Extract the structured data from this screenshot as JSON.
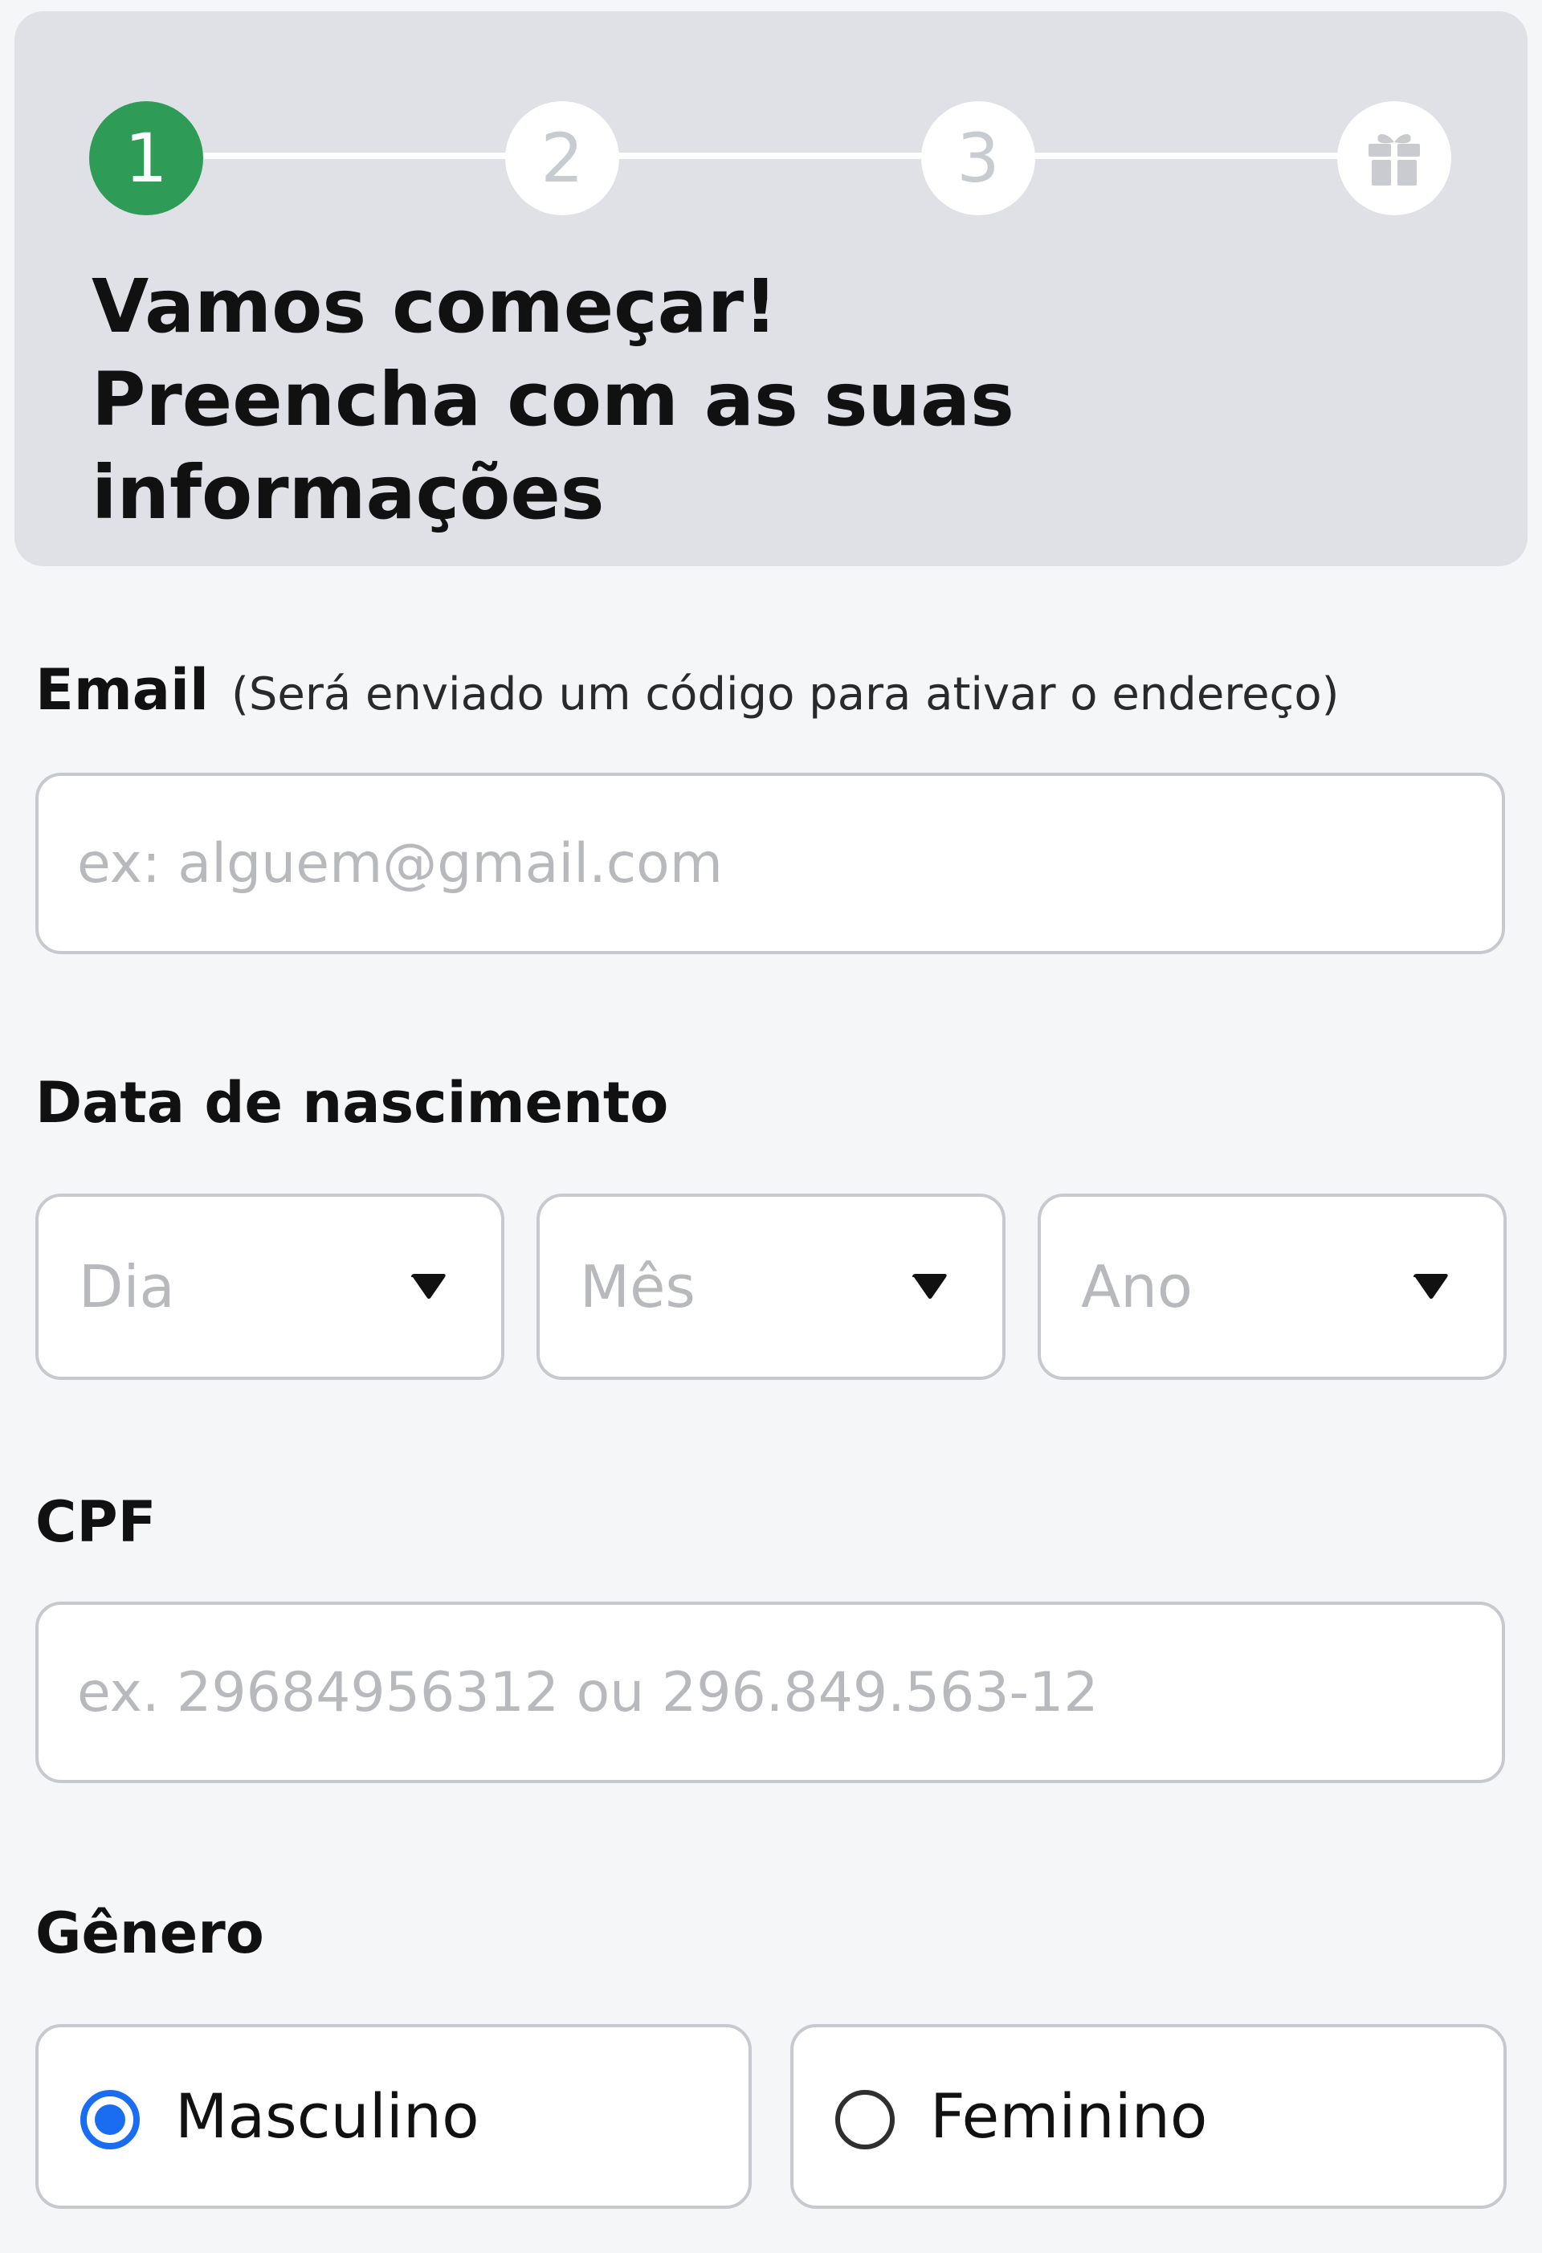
{
  "stepper": {
    "steps": [
      {
        "label": "1",
        "state": "active"
      },
      {
        "label": "2",
        "state": "inactive"
      },
      {
        "label": "3",
        "state": "inactive"
      },
      {
        "icon": "gift-icon",
        "state": "inactive"
      }
    ]
  },
  "header": {
    "title_lines": [
      "Vamos começar!",
      "Preencha com as suas",
      "informações"
    ]
  },
  "email": {
    "label": "Email",
    "hint": "(Será enviado um código para ativar o endereço)",
    "placeholder": "ex: alguem@gmail.com",
    "value": ""
  },
  "birthdate": {
    "label": "Data de nascimento",
    "day_placeholder": "Dia",
    "month_placeholder": "Mês",
    "year_placeholder": "Ano"
  },
  "cpf": {
    "label": "CPF",
    "placeholder": "ex. 29684956312 ou 296.849.563-12",
    "value": ""
  },
  "gender": {
    "label": "Gênero",
    "options": [
      {
        "label": "Masculino",
        "checked": true
      },
      {
        "label": "Feminino",
        "checked": false
      }
    ]
  },
  "colors": {
    "active_step": "#2e9c56",
    "radio_selected": "#1a6df0",
    "header_bg": "#dfe1e6",
    "page_bg": "#f5f6f8"
  }
}
